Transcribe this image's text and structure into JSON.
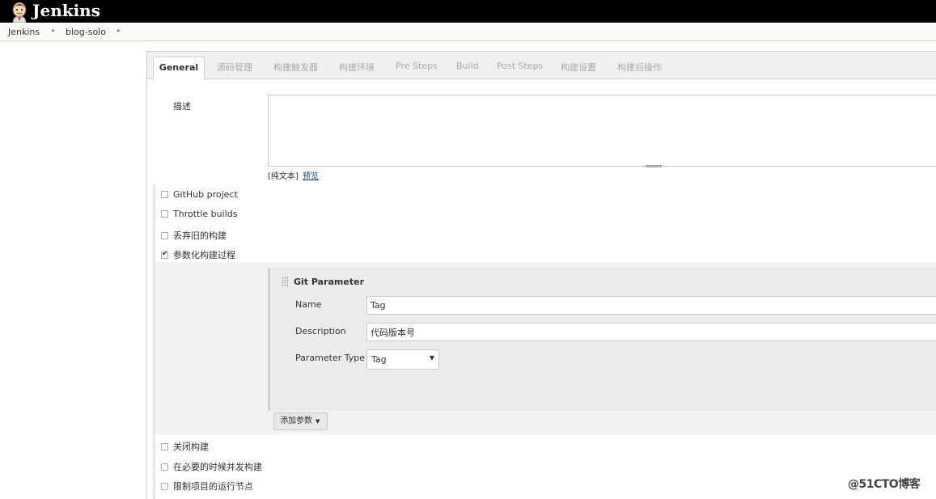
{
  "header": {
    "brand": "Jenkins"
  },
  "breadcrumbs": [
    {
      "label": "Jenkins"
    },
    {
      "label": "blog-solo"
    }
  ],
  "tabs": [
    {
      "label": "General",
      "active": true
    },
    {
      "label": "源码管理"
    },
    {
      "label": "构建触发器"
    },
    {
      "label": "构建环境"
    },
    {
      "label": "Pre Steps"
    },
    {
      "label": "Build"
    },
    {
      "label": "Post Steps"
    },
    {
      "label": "构建设置"
    },
    {
      "label": "构建后操作"
    }
  ],
  "description": {
    "label": "描述",
    "value": "",
    "plain_text": "[纯文本]",
    "preview": "预览"
  },
  "options_top": [
    {
      "label": "GitHub project",
      "checked": false
    },
    {
      "label": "Throttle builds",
      "checked": false
    },
    {
      "label": "丢弃旧的构建",
      "checked": false
    },
    {
      "label": "参数化构建过程",
      "checked": true
    }
  ],
  "git_parameter": {
    "title": "Git Parameter",
    "name_label": "Name",
    "name_value": "Tag",
    "description_label": "Description",
    "description_value": "代码版本号",
    "type_label": "Parameter Type",
    "type_value": "Tag"
  },
  "add_param": {
    "label": "添加参数"
  },
  "options_bottom": [
    {
      "label": "关闭构建",
      "checked": false
    },
    {
      "label": "在必要的时候并发构建",
      "checked": false
    },
    {
      "label": "限制项目的运行节点",
      "checked": false
    }
  ],
  "watermark": "@51CTO博客"
}
